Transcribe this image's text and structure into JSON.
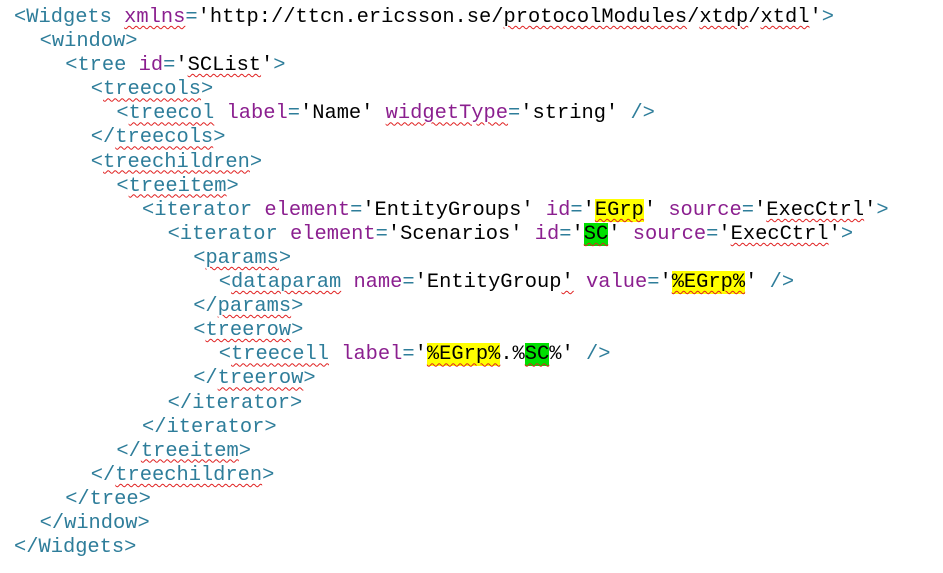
{
  "document": {
    "colors": {
      "punctuation": "#2e7d9a",
      "tag": "#2e7d9a",
      "attribute": "#8b1f8f",
      "value": "#000000",
      "spellcheck_underline": "#e02020",
      "highlight_egrp": "#ffff00",
      "highlight_sc": "#00e000"
    },
    "lines": [
      {
        "indent": 0,
        "tokens": [
          {
            "t": "<",
            "k": "punct"
          },
          {
            "t": "Widgets",
            "k": "tag"
          },
          {
            "t": " ",
            "k": "text"
          },
          {
            "t": "xmlns",
            "k": "attr",
            "spell": true
          },
          {
            "t": "=",
            "k": "punct"
          },
          {
            "t": "'http://ttcn.ericsson.se/",
            "k": "val"
          },
          {
            "t": "protocolModules",
            "k": "val",
            "spell": true
          },
          {
            "t": "/",
            "k": "val"
          },
          {
            "t": "xtdp",
            "k": "val",
            "spell": true
          },
          {
            "t": "/",
            "k": "val"
          },
          {
            "t": "xtdl",
            "k": "val",
            "spell": true
          },
          {
            "t": "'",
            "k": "val"
          },
          {
            "t": ">",
            "k": "punct"
          }
        ]
      },
      {
        "indent": 1,
        "tokens": [
          {
            "t": "<",
            "k": "punct"
          },
          {
            "t": "window",
            "k": "tag"
          },
          {
            "t": ">",
            "k": "punct"
          }
        ]
      },
      {
        "indent": 2,
        "tokens": [
          {
            "t": "<",
            "k": "punct"
          },
          {
            "t": "tree",
            "k": "tag"
          },
          {
            "t": " ",
            "k": "text"
          },
          {
            "t": "id",
            "k": "attr"
          },
          {
            "t": "=",
            "k": "punct"
          },
          {
            "t": "'",
            "k": "val"
          },
          {
            "t": "SCList",
            "k": "val",
            "spell": true
          },
          {
            "t": "'",
            "k": "val"
          },
          {
            "t": ">",
            "k": "punct"
          }
        ]
      },
      {
        "indent": 3,
        "tokens": [
          {
            "t": "<",
            "k": "punct"
          },
          {
            "t": "treecols",
            "k": "tag",
            "spell": true
          },
          {
            "t": ">",
            "k": "punct"
          }
        ]
      },
      {
        "indent": 4,
        "tokens": [
          {
            "t": "<",
            "k": "punct"
          },
          {
            "t": "treecol",
            "k": "tag",
            "spell": true
          },
          {
            "t": " ",
            "k": "text"
          },
          {
            "t": "label",
            "k": "attr"
          },
          {
            "t": "=",
            "k": "punct"
          },
          {
            "t": "'Name'",
            "k": "val"
          },
          {
            "t": " ",
            "k": "text"
          },
          {
            "t": "widgetType",
            "k": "attr",
            "spell": true
          },
          {
            "t": "=",
            "k": "punct"
          },
          {
            "t": "'string'",
            "k": "val"
          },
          {
            "t": " ",
            "k": "text"
          },
          {
            "t": "/>",
            "k": "punct"
          }
        ]
      },
      {
        "indent": 3,
        "tokens": [
          {
            "t": "</",
            "k": "punct"
          },
          {
            "t": "treecols",
            "k": "tag",
            "spell": true
          },
          {
            "t": ">",
            "k": "punct"
          }
        ]
      },
      {
        "indent": 3,
        "tokens": [
          {
            "t": "<",
            "k": "punct"
          },
          {
            "t": "treechildren",
            "k": "tag",
            "spell": true
          },
          {
            "t": ">",
            "k": "punct"
          }
        ]
      },
      {
        "indent": 4,
        "tokens": [
          {
            "t": "<",
            "k": "punct"
          },
          {
            "t": "treeitem",
            "k": "tag",
            "spell": true
          },
          {
            "t": ">",
            "k": "punct"
          }
        ]
      },
      {
        "indent": 5,
        "tokens": [
          {
            "t": "<",
            "k": "punct"
          },
          {
            "t": "iterator",
            "k": "tag"
          },
          {
            "t": " ",
            "k": "text"
          },
          {
            "t": "element",
            "k": "attr"
          },
          {
            "t": "=",
            "k": "punct"
          },
          {
            "t": "'EntityGroups'",
            "k": "val"
          },
          {
            "t": " ",
            "k": "text"
          },
          {
            "t": "id",
            "k": "attr"
          },
          {
            "t": "=",
            "k": "punct"
          },
          {
            "t": "'",
            "k": "val"
          },
          {
            "t": "EGrp",
            "k": "val",
            "spell": true,
            "hl": "yellow"
          },
          {
            "t": "'",
            "k": "val"
          },
          {
            "t": " ",
            "k": "text"
          },
          {
            "t": "source",
            "k": "attr"
          },
          {
            "t": "=",
            "k": "punct"
          },
          {
            "t": "'",
            "k": "val"
          },
          {
            "t": "ExecCtrl",
            "k": "val",
            "spell": true
          },
          {
            "t": "'",
            "k": "val"
          },
          {
            "t": ">",
            "k": "punct"
          }
        ]
      },
      {
        "indent": 6,
        "tokens": [
          {
            "t": "<",
            "k": "punct"
          },
          {
            "t": "iterator",
            "k": "tag"
          },
          {
            "t": " ",
            "k": "text"
          },
          {
            "t": "element",
            "k": "attr"
          },
          {
            "t": "=",
            "k": "punct"
          },
          {
            "t": "'Scenarios'",
            "k": "val"
          },
          {
            "t": " ",
            "k": "text"
          },
          {
            "t": "id",
            "k": "attr"
          },
          {
            "t": "=",
            "k": "punct"
          },
          {
            "t": "'",
            "k": "val"
          },
          {
            "t": "SC",
            "k": "val",
            "spell": true,
            "hl": "green"
          },
          {
            "t": "'",
            "k": "val"
          },
          {
            "t": " ",
            "k": "text"
          },
          {
            "t": "source",
            "k": "attr"
          },
          {
            "t": "=",
            "k": "punct"
          },
          {
            "t": "'",
            "k": "val"
          },
          {
            "t": "ExecCtrl",
            "k": "val",
            "spell": true
          },
          {
            "t": "'",
            "k": "val"
          },
          {
            "t": ">",
            "k": "punct"
          }
        ]
      },
      {
        "indent": 7,
        "tokens": [
          {
            "t": "<",
            "k": "punct"
          },
          {
            "t": "params",
            "k": "tag",
            "spell": true
          },
          {
            "t": ">",
            "k": "punct"
          }
        ]
      },
      {
        "indent": 8,
        "tokens": [
          {
            "t": "<",
            "k": "punct"
          },
          {
            "t": "dataparam",
            "k": "tag",
            "spell": true
          },
          {
            "t": " ",
            "k": "text"
          },
          {
            "t": "name",
            "k": "attr"
          },
          {
            "t": "=",
            "k": "punct"
          },
          {
            "t": "'",
            "k": "val"
          },
          {
            "t": "EntityGroup",
            "k": "val"
          },
          {
            "t": "'",
            "k": "val",
            "spell": true
          },
          {
            "t": " ",
            "k": "text"
          },
          {
            "t": "value",
            "k": "attr"
          },
          {
            "t": "=",
            "k": "punct"
          },
          {
            "t": "'",
            "k": "val"
          },
          {
            "t": "%EGrp%",
            "k": "val",
            "spell": true,
            "hl": "yellow"
          },
          {
            "t": "'",
            "k": "val"
          },
          {
            "t": " ",
            "k": "text"
          },
          {
            "t": "/>",
            "k": "punct"
          }
        ]
      },
      {
        "indent": 7,
        "tokens": [
          {
            "t": "</",
            "k": "punct"
          },
          {
            "t": "params",
            "k": "tag",
            "spell": true
          },
          {
            "t": ">",
            "k": "punct"
          }
        ]
      },
      {
        "indent": 7,
        "tokens": [
          {
            "t": "<",
            "k": "punct"
          },
          {
            "t": "treerow",
            "k": "tag",
            "spell": true
          },
          {
            "t": ">",
            "k": "punct"
          }
        ]
      },
      {
        "indent": 8,
        "tokens": [
          {
            "t": "<",
            "k": "punct"
          },
          {
            "t": "treecell",
            "k": "tag",
            "spell": true
          },
          {
            "t": " ",
            "k": "text"
          },
          {
            "t": "label",
            "k": "attr"
          },
          {
            "t": "=",
            "k": "punct"
          },
          {
            "t": "'",
            "k": "val"
          },
          {
            "t": "%EGrp%",
            "k": "val",
            "spell": true,
            "hl": "yellow"
          },
          {
            "t": ".%",
            "k": "val"
          },
          {
            "t": "SC",
            "k": "val",
            "spell": true,
            "hl": "green"
          },
          {
            "t": "%",
            "k": "val"
          },
          {
            "t": "'",
            "k": "val"
          },
          {
            "t": " ",
            "k": "text"
          },
          {
            "t": "/>",
            "k": "punct"
          }
        ]
      },
      {
        "indent": 7,
        "tokens": [
          {
            "t": "</",
            "k": "punct"
          },
          {
            "t": "treerow",
            "k": "tag",
            "spell": true
          },
          {
            "t": ">",
            "k": "punct"
          }
        ]
      },
      {
        "indent": 6,
        "tokens": [
          {
            "t": "</",
            "k": "punct"
          },
          {
            "t": "iterator",
            "k": "tag"
          },
          {
            "t": ">",
            "k": "punct"
          }
        ]
      },
      {
        "indent": 5,
        "tokens": [
          {
            "t": "</",
            "k": "punct"
          },
          {
            "t": "iterator",
            "k": "tag"
          },
          {
            "t": ">",
            "k": "punct"
          }
        ]
      },
      {
        "indent": 4,
        "tokens": [
          {
            "t": "</",
            "k": "punct"
          },
          {
            "t": "treeitem",
            "k": "tag",
            "spell": true
          },
          {
            "t": ">",
            "k": "punct"
          }
        ]
      },
      {
        "indent": 3,
        "tokens": [
          {
            "t": "</",
            "k": "punct"
          },
          {
            "t": "treechildren",
            "k": "tag",
            "spell": true
          },
          {
            "t": ">",
            "k": "punct"
          }
        ]
      },
      {
        "indent": 2,
        "tokens": [
          {
            "t": "</",
            "k": "punct"
          },
          {
            "t": "tree",
            "k": "tag"
          },
          {
            "t": ">",
            "k": "punct"
          }
        ]
      },
      {
        "indent": 1,
        "tokens": [
          {
            "t": "</",
            "k": "punct"
          },
          {
            "t": "window",
            "k": "tag"
          },
          {
            "t": ">",
            "k": "punct"
          }
        ]
      },
      {
        "indent": 0,
        "tokens": [
          {
            "t": "</",
            "k": "punct"
          },
          {
            "t": "Widgets",
            "k": "tag"
          },
          {
            "t": ">",
            "k": "punct"
          }
        ]
      }
    ]
  }
}
